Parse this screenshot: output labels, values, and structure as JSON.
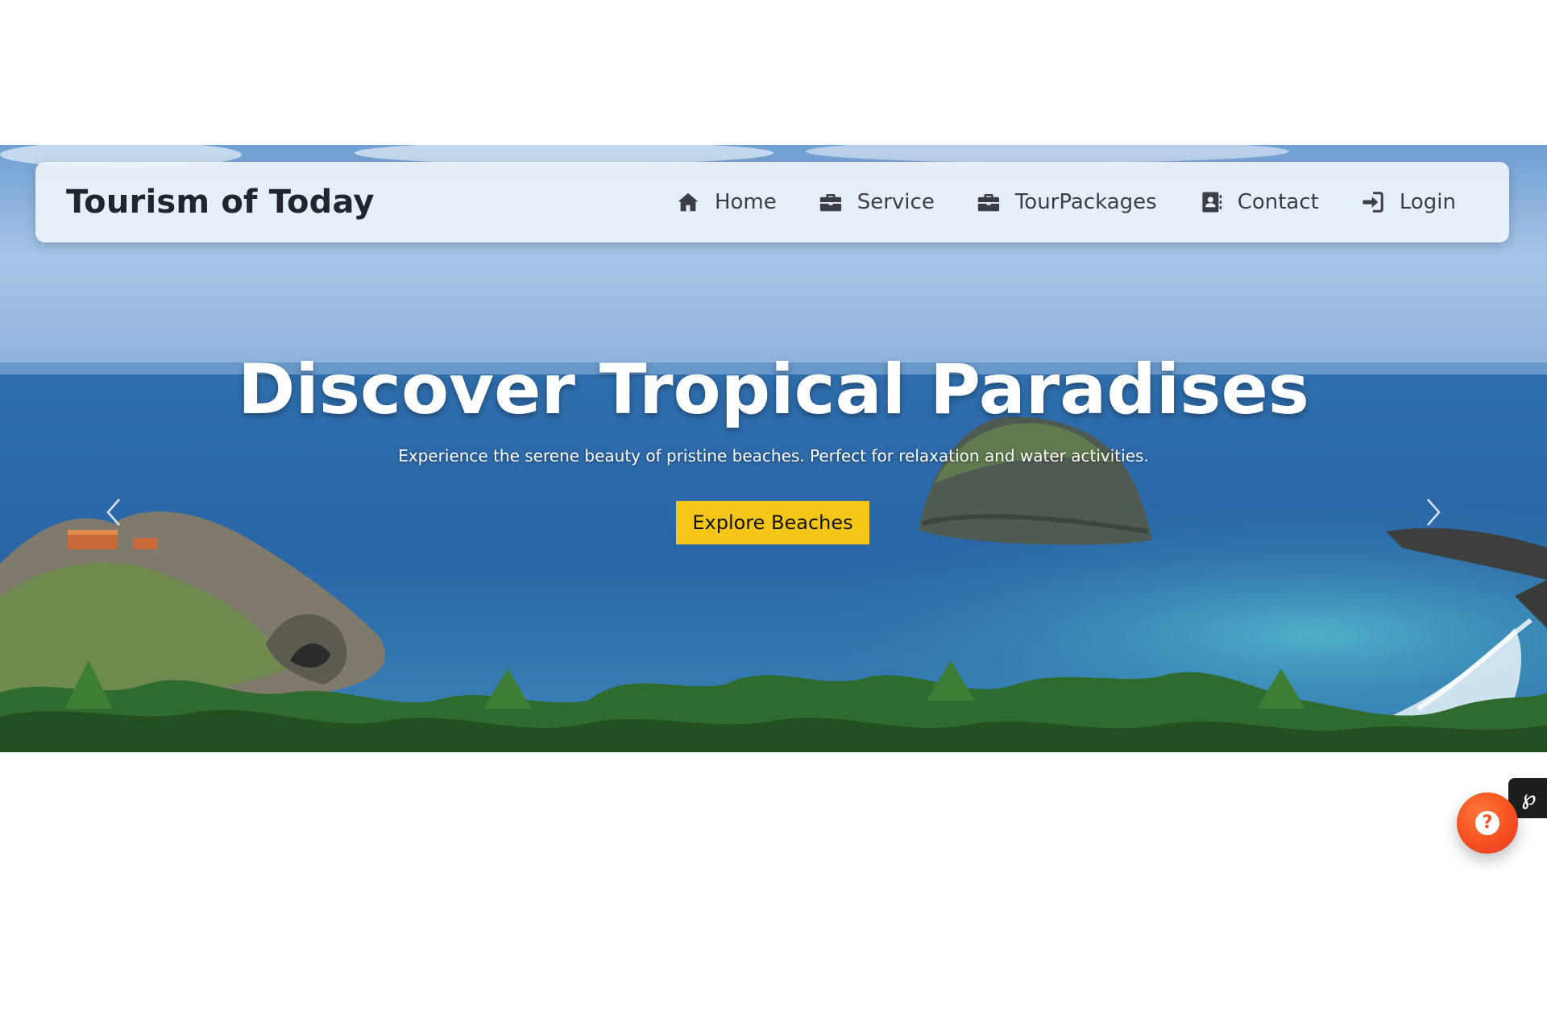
{
  "header": {
    "brand": "Tourism of Today",
    "nav": [
      {
        "label": "Home",
        "icon": "home-icon"
      },
      {
        "label": "Service",
        "icon": "briefcase-icon"
      },
      {
        "label": "TourPackages",
        "icon": "briefcase-icon"
      },
      {
        "label": "Contact",
        "icon": "address-book-icon"
      },
      {
        "label": "Login",
        "icon": "sign-in-icon"
      }
    ]
  },
  "hero": {
    "title": "Discover Tropical Paradises",
    "subtitle": "Experience the serene beauty of pristine beaches. Perfect for relaxation and water activities.",
    "cta_label": "Explore Beaches",
    "prev_icon": "chevron-left-icon",
    "next_icon": "chevron-right-icon"
  },
  "widgets": {
    "badge_text": "℘",
    "help_symbol": "?"
  },
  "colors": {
    "cta": "#f5c518",
    "help_button": "#f4511e",
    "navbar_bg": "#ecf2fa",
    "brand_text": "#1f2630"
  }
}
